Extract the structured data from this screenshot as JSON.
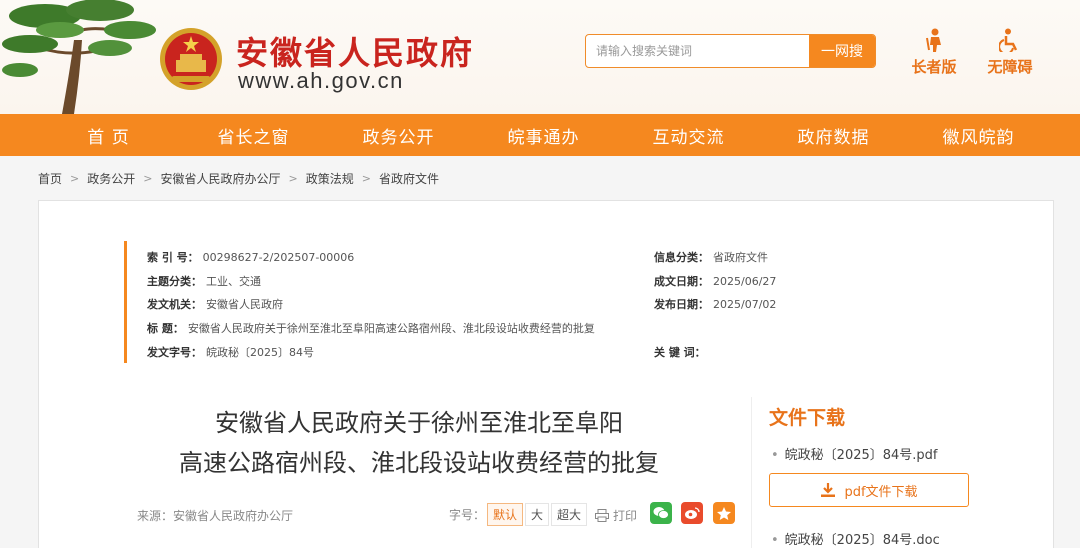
{
  "header": {
    "site_title": "安徽省人民政府",
    "site_url": "www.ah.gov.cn",
    "search_placeholder": "请输入搜索关键词",
    "search_button": "一网搜",
    "quick_links": [
      {
        "label": "长者版",
        "icon": "elder-icon"
      },
      {
        "label": "无障碍",
        "icon": "wheelchair-icon"
      }
    ],
    "brand_color": "#f5881f",
    "title_color": "#c9241e"
  },
  "nav": {
    "items": [
      "首  页",
      "省长之窗",
      "政务公开",
      "皖事通办",
      "互动交流",
      "政府数据",
      "徽风皖韵"
    ]
  },
  "breadcrumb": [
    "首页",
    "政务公开",
    "安徽省人民政府办公厅",
    "政策法规",
    "省政府文件"
  ],
  "meta": {
    "index_label": "索 引 号：",
    "index_value": "00298627-2/202507-00006",
    "topic_label": "主题分类：",
    "topic_value": "工业、交通",
    "issuer_label": "发文机关：",
    "issuer_value": "安徽省人民政府",
    "title_label": "标      题：",
    "title_value": "安徽省人民政府关于徐州至淮北至阜阳高速公路宿州段、淮北段设站收费经营的批复",
    "docno_label": "发文字号：",
    "docno_value": "皖政秘〔2025〕84号",
    "category_label": "信息分类：",
    "category_value": "省政府文件",
    "created_label": "成文日期：",
    "created_value": "2025/06/27",
    "published_label": "发布日期：",
    "published_value": "2025/07/02",
    "keywords_label": "关 键 词：",
    "keywords_value": ""
  },
  "document": {
    "title_line1": "安徽省人民政府关于徐州至淮北至阜阳",
    "title_line2": "高速公路宿州段、淮北段设站收费经营的批复",
    "source": "来源：安徽省人民政府办公厅",
    "fontsize_label": "字号：",
    "fontsize_options": [
      "默认",
      "大",
      "超大"
    ],
    "print_label": "打印"
  },
  "downloads": {
    "title": "文件下载",
    "pdf_file": "皖政秘〔2025〕84号.pdf",
    "pdf_button": "pdf文件下载",
    "doc_file": "皖政秘〔2025〕84号.doc"
  }
}
